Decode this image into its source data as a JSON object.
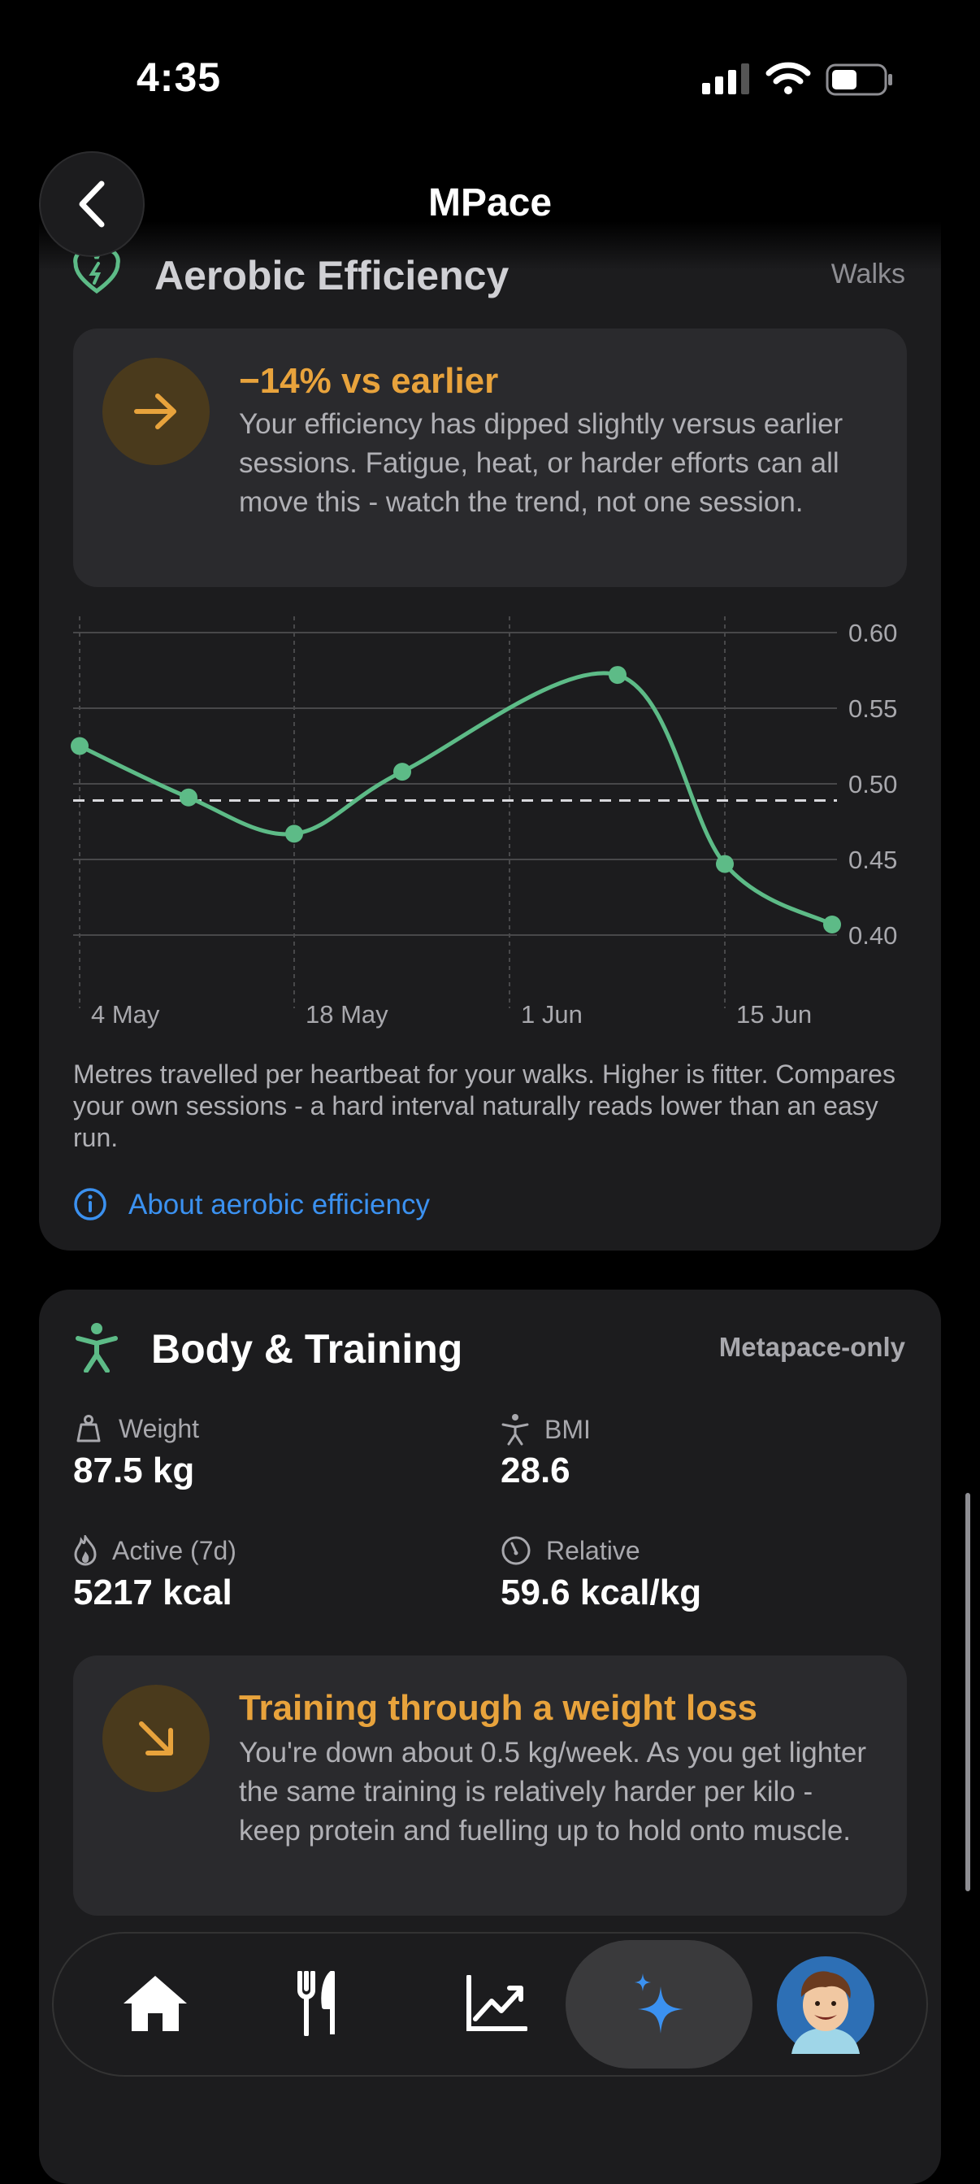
{
  "status_bar": {
    "time": "4:35"
  },
  "header": {
    "title": "MPace"
  },
  "aerobic": {
    "title": "Aerobic Efficiency",
    "filter": "Walks",
    "insight": {
      "headline": "−14% vs earlier",
      "text": "Your efficiency has dipped slightly versus earlier sessions. Fatigue, heat, or harder efforts can all move this - watch the trend, not one session."
    },
    "description": "Metres travelled per heartbeat for your walks. Higher is fitter. Compares your own sessions - a hard interval naturally reads lower than an easy run.",
    "about_link": "About aerobic efficiency"
  },
  "chart_data": {
    "type": "line",
    "x": [
      "4 May",
      "11 May",
      "18 May",
      "25 May",
      "8 Jun",
      "15 Jun",
      "22 Jun"
    ],
    "x_ticks": [
      "4 May",
      "18 May",
      "1 Jun",
      "15 Jun"
    ],
    "series": [
      {
        "values": [
          0.525,
          0.491,
          0.467,
          0.508,
          0.572,
          0.447,
          0.407
        ]
      }
    ],
    "average_line": 0.489,
    "ylim": [
      0.4,
      0.6
    ],
    "y_ticks": [
      "0.60",
      "0.55",
      "0.50",
      "0.45",
      "0.40"
    ],
    "grid": true,
    "line_color": "#5dbb87"
  },
  "body_training": {
    "title": "Body & Training",
    "badge": "Metapace-only",
    "stats": [
      {
        "label": "Weight",
        "value": "87.5 kg",
        "icon": "scale-icon"
      },
      {
        "label": "BMI",
        "value": "28.6",
        "icon": "figure-icon"
      },
      {
        "label": "Active (7d)",
        "value": "5217 kcal",
        "icon": "flame-icon"
      },
      {
        "label": "Relative",
        "value": "59.6 kcal/kg",
        "icon": "gauge-icon"
      }
    ],
    "insight": {
      "headline": "Training through a weight loss",
      "text": "You're down about 0.5 kg/week. As you get lighter the same training is relatively harder per kilo - keep protein and fuelling up to hold onto muscle."
    }
  },
  "tabbar": {
    "tabs": [
      "home-icon",
      "fork-knife-icon",
      "trend-chart-icon",
      "sparkles-icon",
      "avatar"
    ],
    "active_tab": "sparkles-icon"
  },
  "colors": {
    "accent_green": "#5dbb87",
    "accent_orange": "#e8a33c",
    "link_blue": "#3b91f0"
  }
}
